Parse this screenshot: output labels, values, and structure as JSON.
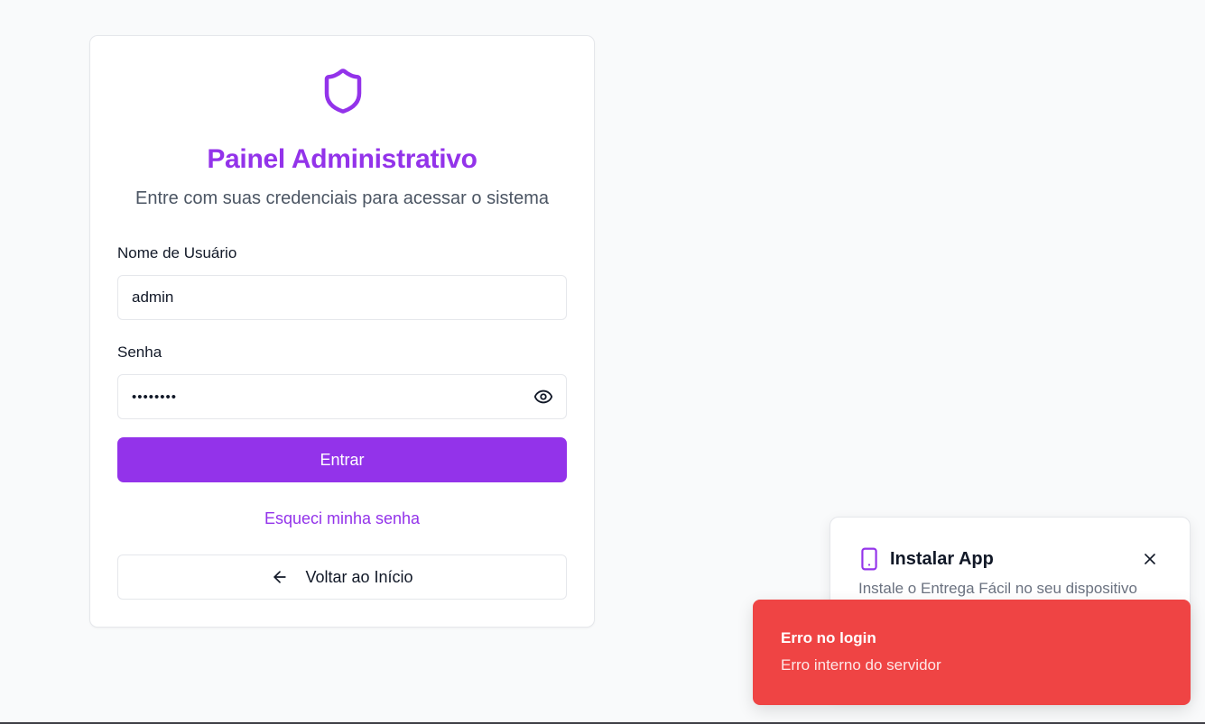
{
  "login": {
    "title": "Painel Administrativo",
    "subtitle": "Entre com suas credenciais para acessar o sistema",
    "username_label": "Nome de Usuário",
    "username_value": "admin",
    "password_label": "Senha",
    "password_value": "••••••••",
    "submit_label": "Entrar",
    "forgot_label": "Esqueci minha senha",
    "back_label": "Voltar ao Início"
  },
  "install_prompt": {
    "title": "Instalar App",
    "description": "Instale o Entrega Fácil no seu dispositivo"
  },
  "toast": {
    "title": "Erro no login",
    "description": "Erro interno do servidor"
  },
  "icons": {
    "shield": "shield-icon",
    "eye": "eye-icon",
    "arrow_left": "arrow-left-icon",
    "smartphone": "smartphone-icon",
    "close": "close-icon"
  },
  "colors": {
    "accent": "#9333ea",
    "error": "#ef4444",
    "background": "#f9fafb"
  }
}
